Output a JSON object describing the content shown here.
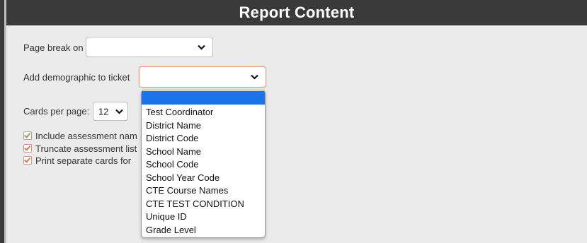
{
  "header": {
    "title": "Report Content"
  },
  "page_break": {
    "label": "Page break on",
    "value": ""
  },
  "demographic": {
    "label": "Add demographic to ticket",
    "value": ""
  },
  "cards_per_page": {
    "label": "Cards per page:",
    "value": "12"
  },
  "checkboxes": [
    {
      "label": "Include assessment nam",
      "checked": true
    },
    {
      "label": "Truncate assessment list",
      "checked": true
    },
    {
      "label": "Print separate cards for",
      "checked": true
    }
  ],
  "dropdown": {
    "highlighted": "",
    "options": [
      "Test Coordinator",
      "District Name",
      "District Code",
      "School Name",
      "School Code",
      "School Year Code",
      "CTE Course Names",
      "CTE TEST CONDITION",
      "Unique ID",
      "Grade Level"
    ]
  },
  "colors": {
    "header_bg": "#3a3a3a",
    "focus_border": "#e09a86",
    "highlight": "#1a73e8",
    "check": "#d9785a"
  }
}
